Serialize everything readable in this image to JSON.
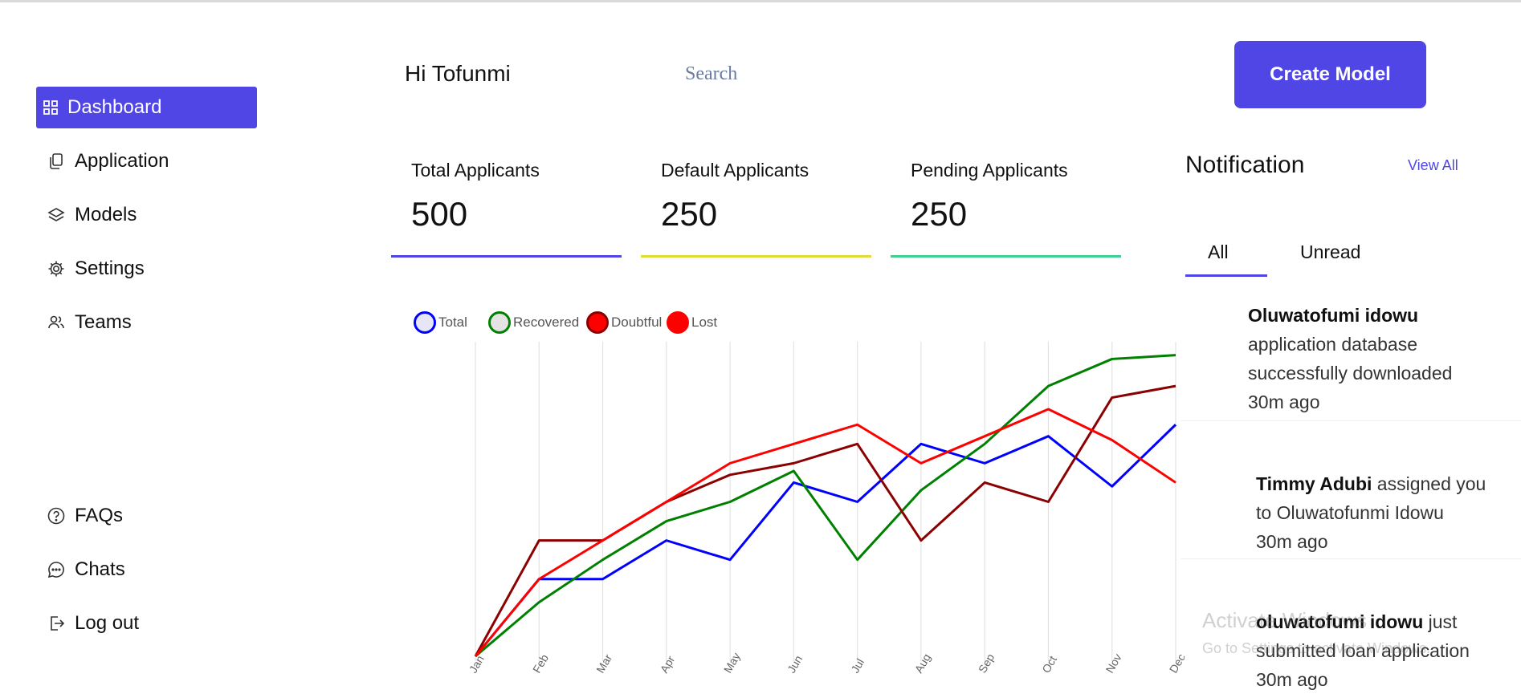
{
  "sidebar": {
    "top_items": [
      {
        "label": "Dashboard",
        "icon": "grid-icon",
        "active": true
      },
      {
        "label": "Application",
        "icon": "copy-icon",
        "active": false
      },
      {
        "label": "Models",
        "icon": "layers-icon",
        "active": false
      },
      {
        "label": "Settings",
        "icon": "gear-icon",
        "active": false
      },
      {
        "label": "Teams",
        "icon": "users-icon",
        "active": false
      }
    ],
    "bottom_items": [
      {
        "label": "FAQs",
        "icon": "question-circle-icon"
      },
      {
        "label": "Chats",
        "icon": "chat-bubble-icon"
      },
      {
        "label": "Log out",
        "icon": "logout-icon"
      }
    ]
  },
  "header": {
    "greeting": "Hi Tofunmi",
    "search_placeholder": "Search",
    "create_button": "Create Model"
  },
  "stats": [
    {
      "label": "Total Applicants",
      "value": "500",
      "color": "#4f46e5"
    },
    {
      "label": "Default Applicants",
      "value": "250",
      "color": "#e2d93a"
    },
    {
      "label": "Pending Applicants",
      "value": "250",
      "color": "#3fcf8e"
    }
  ],
  "notifications": {
    "title": "Notification",
    "view_all": "View All",
    "tabs": [
      {
        "label": "All",
        "active": true
      },
      {
        "label": "Unread",
        "active": false
      }
    ],
    "items": [
      {
        "name": "Oluwatofumi idowu",
        "lines": [
          "application database",
          "successfully downloaded"
        ],
        "time": "30m ago"
      },
      {
        "name": "Timmy Adubi",
        "after_name": " assigned you",
        "lines": [
          "to Oluwatofunmi Idowu"
        ],
        "time": "30m ago"
      },
      {
        "name": "oluwatofumi idowu",
        "after_name": " just",
        "lines": [
          "submitted loan application"
        ],
        "time": "30m ago"
      }
    ]
  },
  "watermark": {
    "line1": "Activate Windows",
    "line2": "Go to Settings to activate Windows."
  },
  "colors": {
    "accent": "#4f46e5"
  },
  "chart_data": {
    "type": "line",
    "x": [
      "Jan",
      "Feb",
      "Mar",
      "Apr",
      "May",
      "Jun",
      "Jul",
      "Aug",
      "Sep",
      "Oct",
      "Nov",
      "Dec"
    ],
    "ylim": [
      0,
      80
    ],
    "grid": "vertical",
    "legend_position": "top-left",
    "series": [
      {
        "name": "Total",
        "color": "#0000ff",
        "values": [
          0,
          20,
          20,
          30,
          25,
          45,
          40,
          55,
          50,
          57,
          44,
          60
        ]
      },
      {
        "name": "Recovered",
        "color": "#008000",
        "values": [
          0,
          14,
          25,
          35,
          40,
          48,
          25,
          43,
          55,
          70,
          77,
          78
        ]
      },
      {
        "name": "Doubtful",
        "color": "#8b0000",
        "values": [
          0,
          30,
          30,
          40,
          47,
          50,
          55,
          30,
          45,
          40,
          67,
          70
        ]
      },
      {
        "name": "Lost",
        "color": "#ff0000",
        "values": [
          0,
          20,
          30,
          40,
          50,
          55,
          60,
          50,
          57,
          64,
          56,
          45
        ]
      }
    ]
  }
}
